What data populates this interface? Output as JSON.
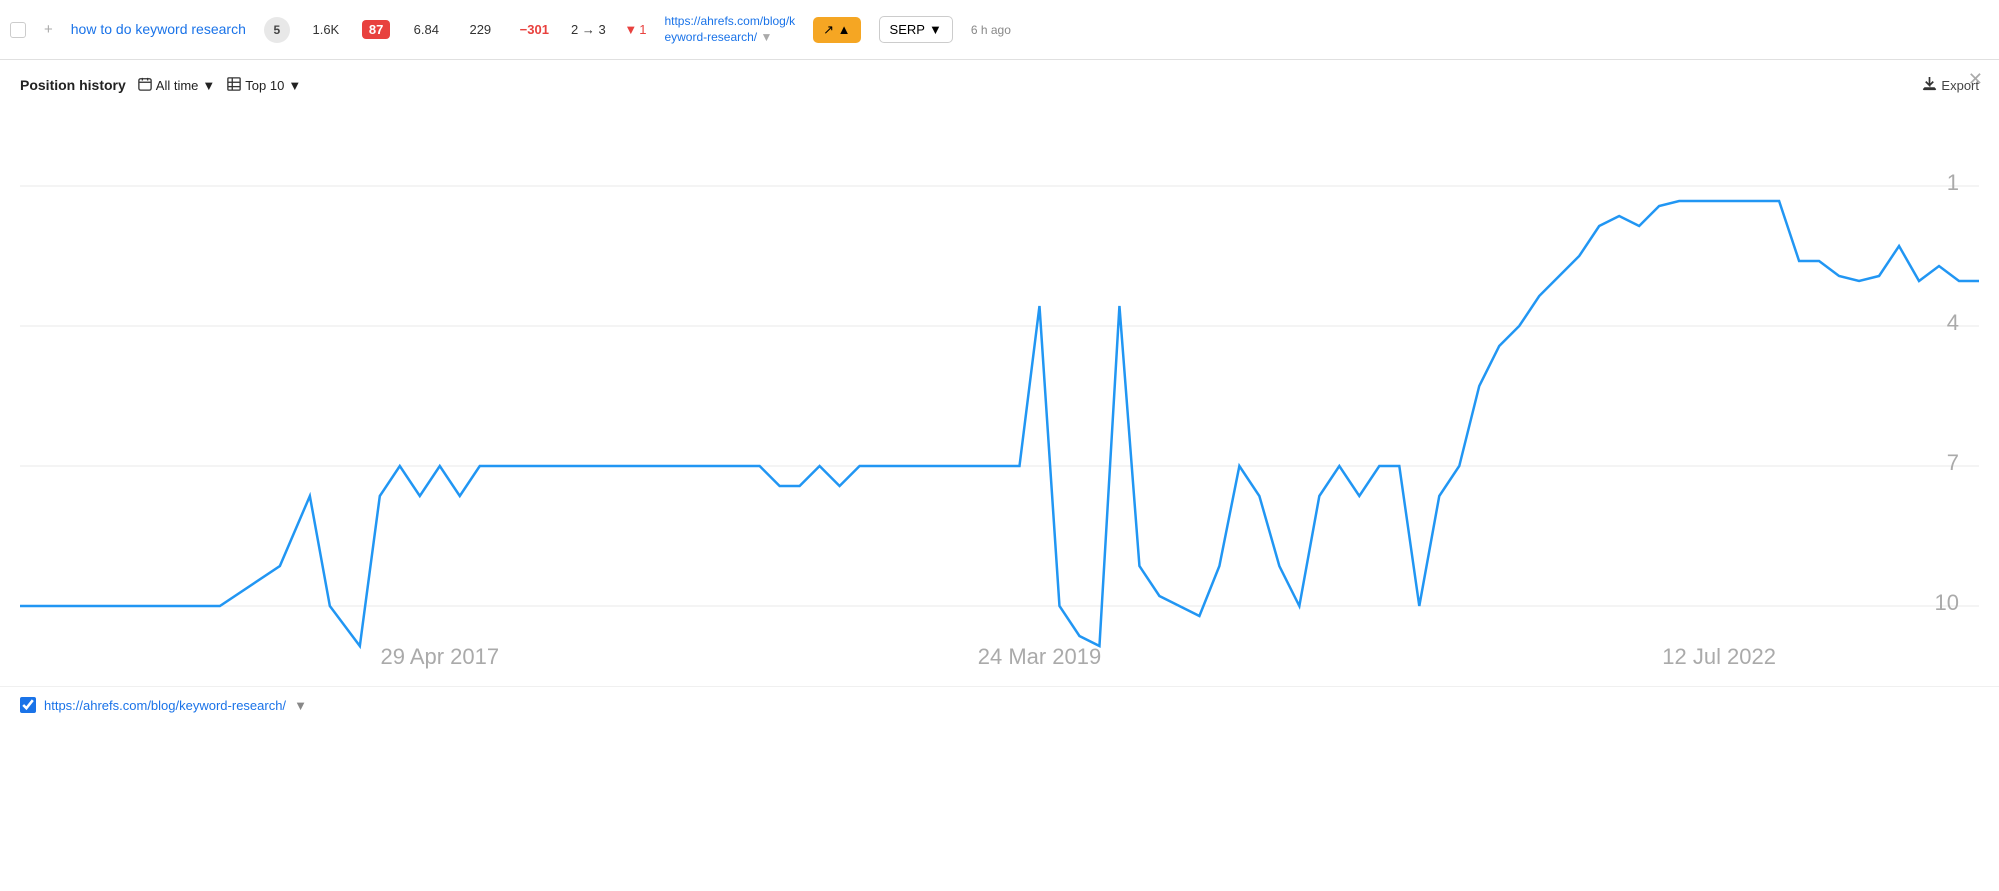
{
  "topRow": {
    "keyword": "how to do keyword research",
    "position": "5",
    "volume": "1.6K",
    "kd": "87",
    "cpc": "6.84",
    "traffic": "229",
    "change": "−301",
    "rank_change": "2 → 3",
    "drop_icon": "▼",
    "drop_count": "1",
    "url": "https://ahrefs.com/blog/keyword-research/",
    "url_short": "https://ahrefs.com/blog/k\neyword-research/",
    "chart_btn": "SERP",
    "time_ago": "6 h ago"
  },
  "panel": {
    "title": "Position history",
    "filter_time": "All time",
    "filter_top": "Top 10",
    "export_label": "Export"
  },
  "chart": {
    "x_labels": [
      "29 Apr 2017",
      "24 Mar 2019",
      "12 Jul 2022"
    ],
    "y_labels": [
      "1",
      "4",
      "7",
      "10"
    ]
  },
  "bottomRow": {
    "url": "https://ahrefs.com/blog/keyword-research/",
    "checked": true
  },
  "icons": {
    "checkbox": "☐",
    "add": "+",
    "calendar": "📅",
    "table": "⊞",
    "download": "⬇",
    "close": "✕",
    "trend_up": "↗",
    "trend_up2": "▲",
    "chevron": "▼"
  }
}
